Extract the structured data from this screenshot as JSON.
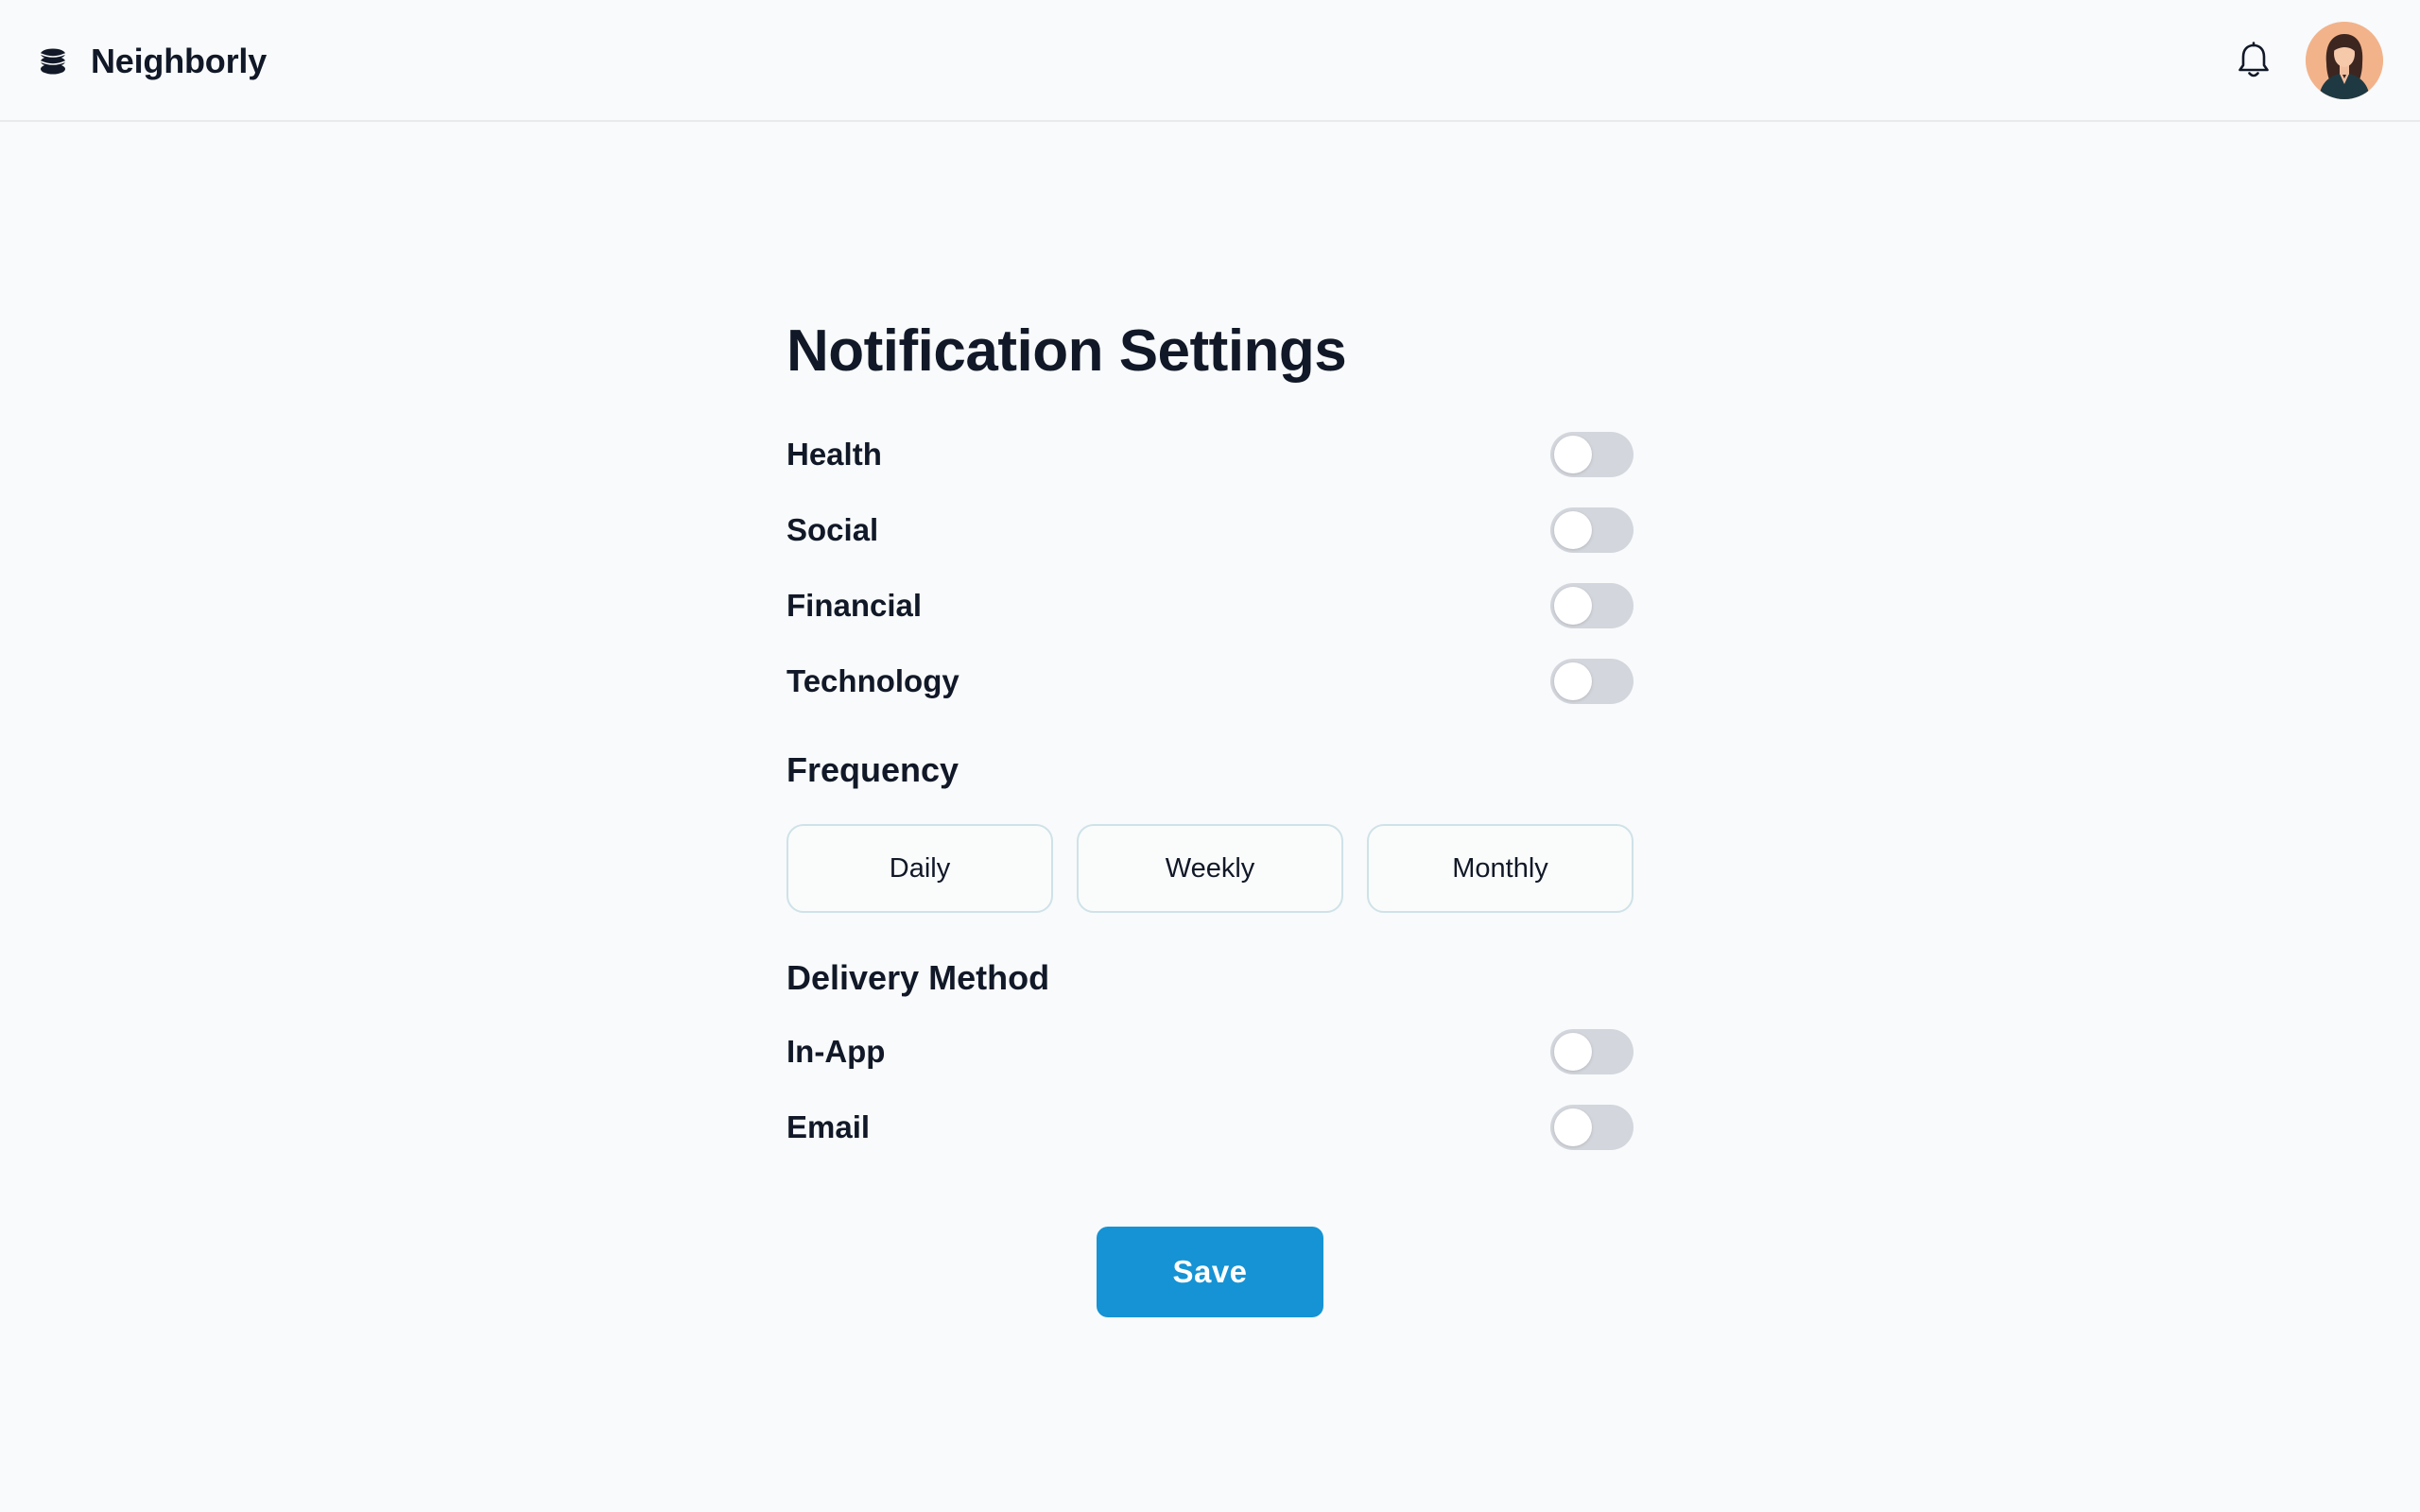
{
  "header": {
    "app_name": "Neighborly",
    "logo_icon": "stack-icon",
    "bell_icon": "bell-icon"
  },
  "main": {
    "title": "Notification Settings",
    "categories": [
      {
        "label": "Health",
        "enabled": false
      },
      {
        "label": "Social",
        "enabled": false
      },
      {
        "label": "Financial",
        "enabled": false
      },
      {
        "label": "Technology",
        "enabled": false
      }
    ],
    "frequency": {
      "title": "Frequency",
      "options": [
        "Daily",
        "Weekly",
        "Monthly"
      ]
    },
    "delivery": {
      "title": "Delivery Method",
      "methods": [
        {
          "label": "In-App",
          "enabled": false
        },
        {
          "label": "Email",
          "enabled": false
        }
      ]
    },
    "save_label": "Save"
  },
  "colors": {
    "accent": "#1593d4",
    "toggle_off": "#d3d6dc",
    "background": "#f8fafb",
    "text": "#111827"
  }
}
